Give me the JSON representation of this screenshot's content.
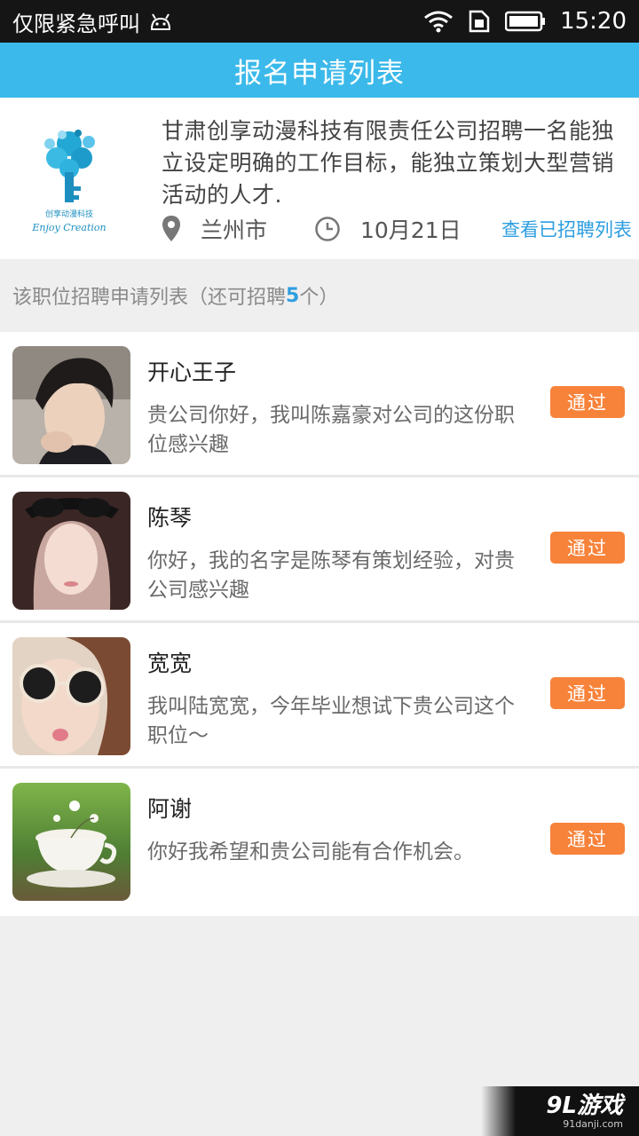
{
  "status_bar": {
    "carrier": "仅限紧急呼叫",
    "time": "15:20",
    "icons": [
      "android-icon",
      "wifi-icon",
      "sim-icon",
      "battery-icon"
    ]
  },
  "title": "报名申请列表",
  "job": {
    "logo_text_top": "创享动漫科技",
    "logo_text_bottom": "Enjoy Creation",
    "description": "甘肃创享动漫科技有限责任公司招聘一名能独立设定明确的工作目标，能独立策划大型营销活动的人才.",
    "city": "兰州市",
    "date": "10月21日",
    "view_hired_link": "查看已招聘列表"
  },
  "section": {
    "prefix": "该职位招聘申请列表（还可招聘",
    "count": "5",
    "suffix": "个）"
  },
  "applicants": [
    {
      "name": "开心王子",
      "message": "贵公司你好，我叫陈嘉豪对公司的这份职位感兴趣",
      "button": "通过"
    },
    {
      "name": "陈琴",
      "message": "你好，我的名字是陈琴有策划经验，对贵公司感兴趣",
      "button": "通过"
    },
    {
      "name": "宽宽",
      "message": "我叫陆宽宽，今年毕业想试下贵公司这个职位～",
      "button": "通过"
    },
    {
      "name": "阿谢",
      "message": "你好我希望和贵公司能有合作机会。",
      "button": "通过"
    }
  ],
  "watermark": {
    "brand": "9L游戏",
    "url": "91danji.com"
  },
  "colors": {
    "title_bar": "#3bb9ea",
    "accent_blue": "#2e9ee0",
    "pass_button": "#f7833b"
  }
}
